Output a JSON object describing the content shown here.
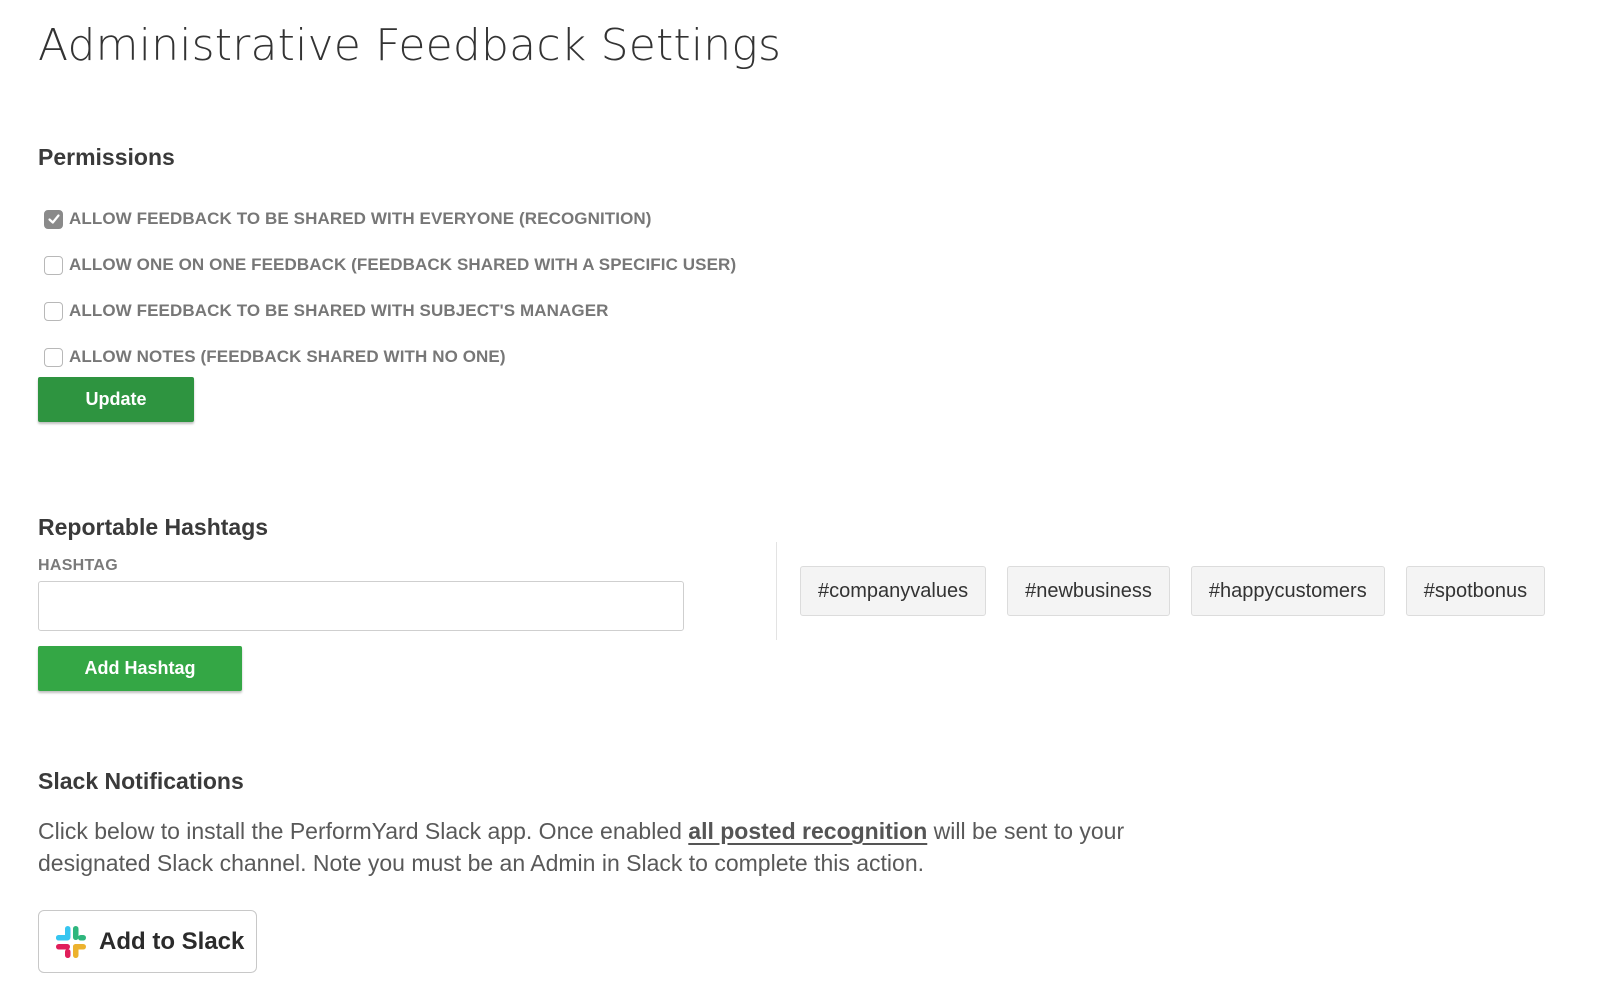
{
  "page": {
    "title": "Administrative Feedback Settings"
  },
  "permissions": {
    "heading": "Permissions",
    "options": [
      {
        "label": "ALLOW FEEDBACK TO BE SHARED WITH EVERYONE (RECOGNITION)",
        "checked": true
      },
      {
        "label": "ALLOW ONE ON ONE FEEDBACK (FEEDBACK SHARED WITH A SPECIFIC USER)",
        "checked": false
      },
      {
        "label": "ALLOW FEEDBACK TO BE SHARED WITH SUBJECT'S MANAGER",
        "checked": false
      },
      {
        "label": "ALLOW NOTES (FEEDBACK SHARED WITH NO ONE)",
        "checked": false
      }
    ],
    "update_label": "Update"
  },
  "hashtags": {
    "heading": "Reportable Hashtags",
    "field_label": "HASHTAG",
    "input_value": "",
    "add_label": "Add Hashtag",
    "tags": [
      "#companyvalues",
      "#newbusiness",
      "#happycustomers",
      "#spotbonus"
    ]
  },
  "slack": {
    "heading": "Slack Notifications",
    "text_before": "Click below to install the PerformYard Slack app. Once enabled ",
    "link_text": "all posted recognition",
    "text_after": " will be sent to your designated Slack channel. Note you must be an Admin in Slack to complete this action.",
    "button_label": "Add to Slack",
    "button_icon": "slack-logo-icon"
  },
  "colors": {
    "update_button": "#2e9440",
    "add_hashtag_button": "#34a745",
    "checkbox_checked": "#8a8a8a"
  }
}
